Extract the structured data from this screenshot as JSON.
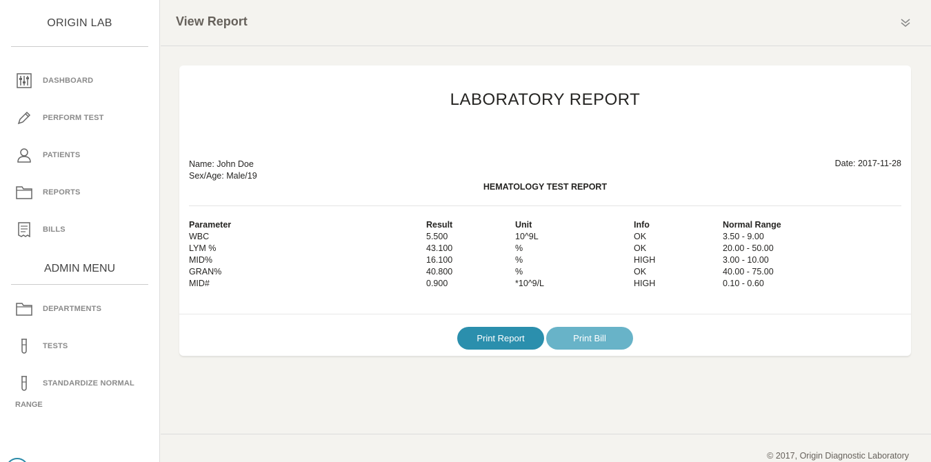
{
  "sidebar": {
    "brand": "ORIGIN LAB",
    "items": [
      {
        "label": "DASHBOARD",
        "icon": "sliders-icon"
      },
      {
        "label": "PERFORM TEST",
        "icon": "pencil-icon"
      },
      {
        "label": "PATIENTS",
        "icon": "user-icon"
      },
      {
        "label": "REPORTS",
        "icon": "folder-icon"
      },
      {
        "label": "BILLS",
        "icon": "receipt-icon"
      }
    ],
    "admin_title": "ADMIN MENU",
    "admin_items": [
      {
        "label": "DEPARTMENTS",
        "icon": "folder-icon"
      },
      {
        "label": "TESTS",
        "icon": "test-tube-icon"
      },
      {
        "label_line1": "STANDARDIZE NORMAL",
        "label_line2": "RANGE",
        "icon": "test-tube-icon"
      }
    ]
  },
  "header": {
    "title": "View Report"
  },
  "report": {
    "title": "LABORATORY REPORT",
    "name": "Name: John Doe",
    "sex_age": "Sex/Age: Male/19",
    "date": "Date: 2017-11-28",
    "subtitle": "HEMATOLOGY TEST REPORT",
    "columns": [
      "Parameter",
      "Result",
      "Unit",
      "Info",
      "Normal Range"
    ],
    "rows": [
      [
        "WBC",
        "5.500",
        "10^9L",
        "OK",
        "3.50 - 9.00"
      ],
      [
        "LYM %",
        "43.100",
        "%",
        "OK",
        "20.00 - 50.00"
      ],
      [
        "MID%",
        "16.100",
        "%",
        "HIGH",
        "3.00 - 10.00"
      ],
      [
        "GRAN%",
        "40.800",
        "%",
        "OK",
        "40.00 - 75.00"
      ],
      [
        "MID#",
        "0.900",
        "*10^9/L",
        "HIGH",
        "0.10 - 0.60"
      ]
    ]
  },
  "actions": {
    "print_report": "Print Report",
    "print_bill": "Print Bill"
  },
  "footer": {
    "copyright": "© 2017, Origin Diagnostic Laboratory"
  },
  "colors": {
    "accent": "#2b8fad",
    "accent_light": "#68b3c8",
    "background": "#f4f3ef"
  }
}
